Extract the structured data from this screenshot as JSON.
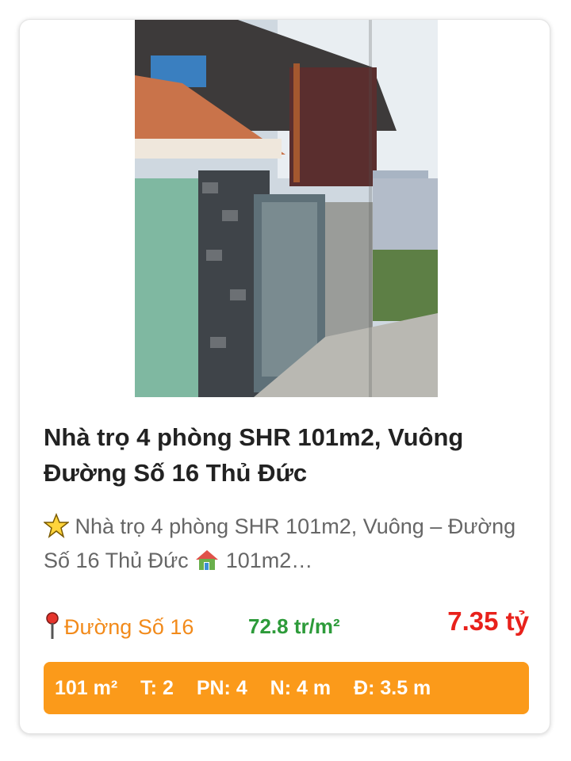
{
  "listing": {
    "image_alt": "house-photo",
    "title": "Nhà trọ 4 phòng SHR 101m2, Vuông Đường Số 16 Thủ Đức",
    "desc_part1": "Nhà trọ 4 phòng SHR 101m2, Vuông – Đường Số 16 Thủ Đức",
    "desc_part2": "101m2…",
    "desc_icons": [
      "star-icon",
      "house-icon"
    ],
    "location_icon": "pin-icon",
    "location": "Đường Số 16",
    "price_per_m2": "72.8 tr/m²",
    "price": "7.35 tỷ",
    "specs": {
      "area": "101 m²",
      "floors": "T: 2",
      "bedrooms": "PN: 4",
      "width": "N: 4 m",
      "road": "Đ: 3.5 m"
    },
    "colors": {
      "location": "#f28a1a",
      "price_per_m2": "#2d9b3a",
      "price": "#e8211b",
      "specs_bg": "#fb9a1a"
    }
  }
}
